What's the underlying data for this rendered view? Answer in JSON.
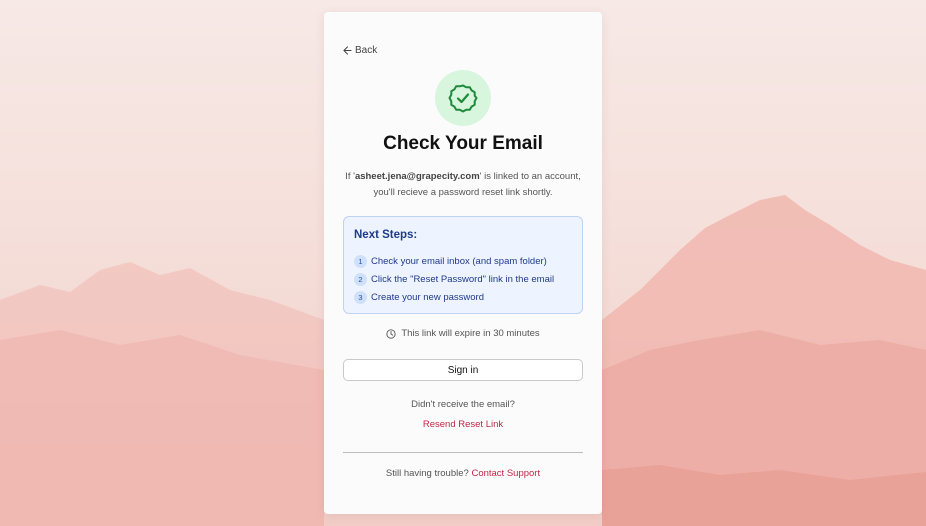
{
  "back": {
    "label": "Back",
    "icon": "arrow-left-icon"
  },
  "status": {
    "icon": "check-badge-icon",
    "title": "Check Your Email"
  },
  "message": {
    "prefix": "If '",
    "email": "asheet.jena@grapecity.com",
    "suffix": "' is linked to an account,",
    "line2": "you'll recieve a password reset link shortly."
  },
  "next_steps": {
    "title": "Next Steps:",
    "items": [
      {
        "num": "1",
        "text": "Check your email inbox (and spam folder)"
      },
      {
        "num": "2",
        "text": "Click the \"Reset Password\" link in the email"
      },
      {
        "num": "3",
        "text": "Create your new password"
      }
    ]
  },
  "expiry": {
    "icon": "clock-icon",
    "text": "This link will expire in 30 minutes"
  },
  "signin": {
    "label": "Sign in"
  },
  "resend": {
    "question": "Didn't receive the email?",
    "link": "Resend Reset Link"
  },
  "support": {
    "prefix": "Still having trouble? ",
    "link": "Contact Support"
  },
  "colors": {
    "accent_link": "#c0264a",
    "steps_text": "#1e3a8a",
    "success_bg": "#d8f5dd",
    "success_icon": "#1f8a3b"
  }
}
